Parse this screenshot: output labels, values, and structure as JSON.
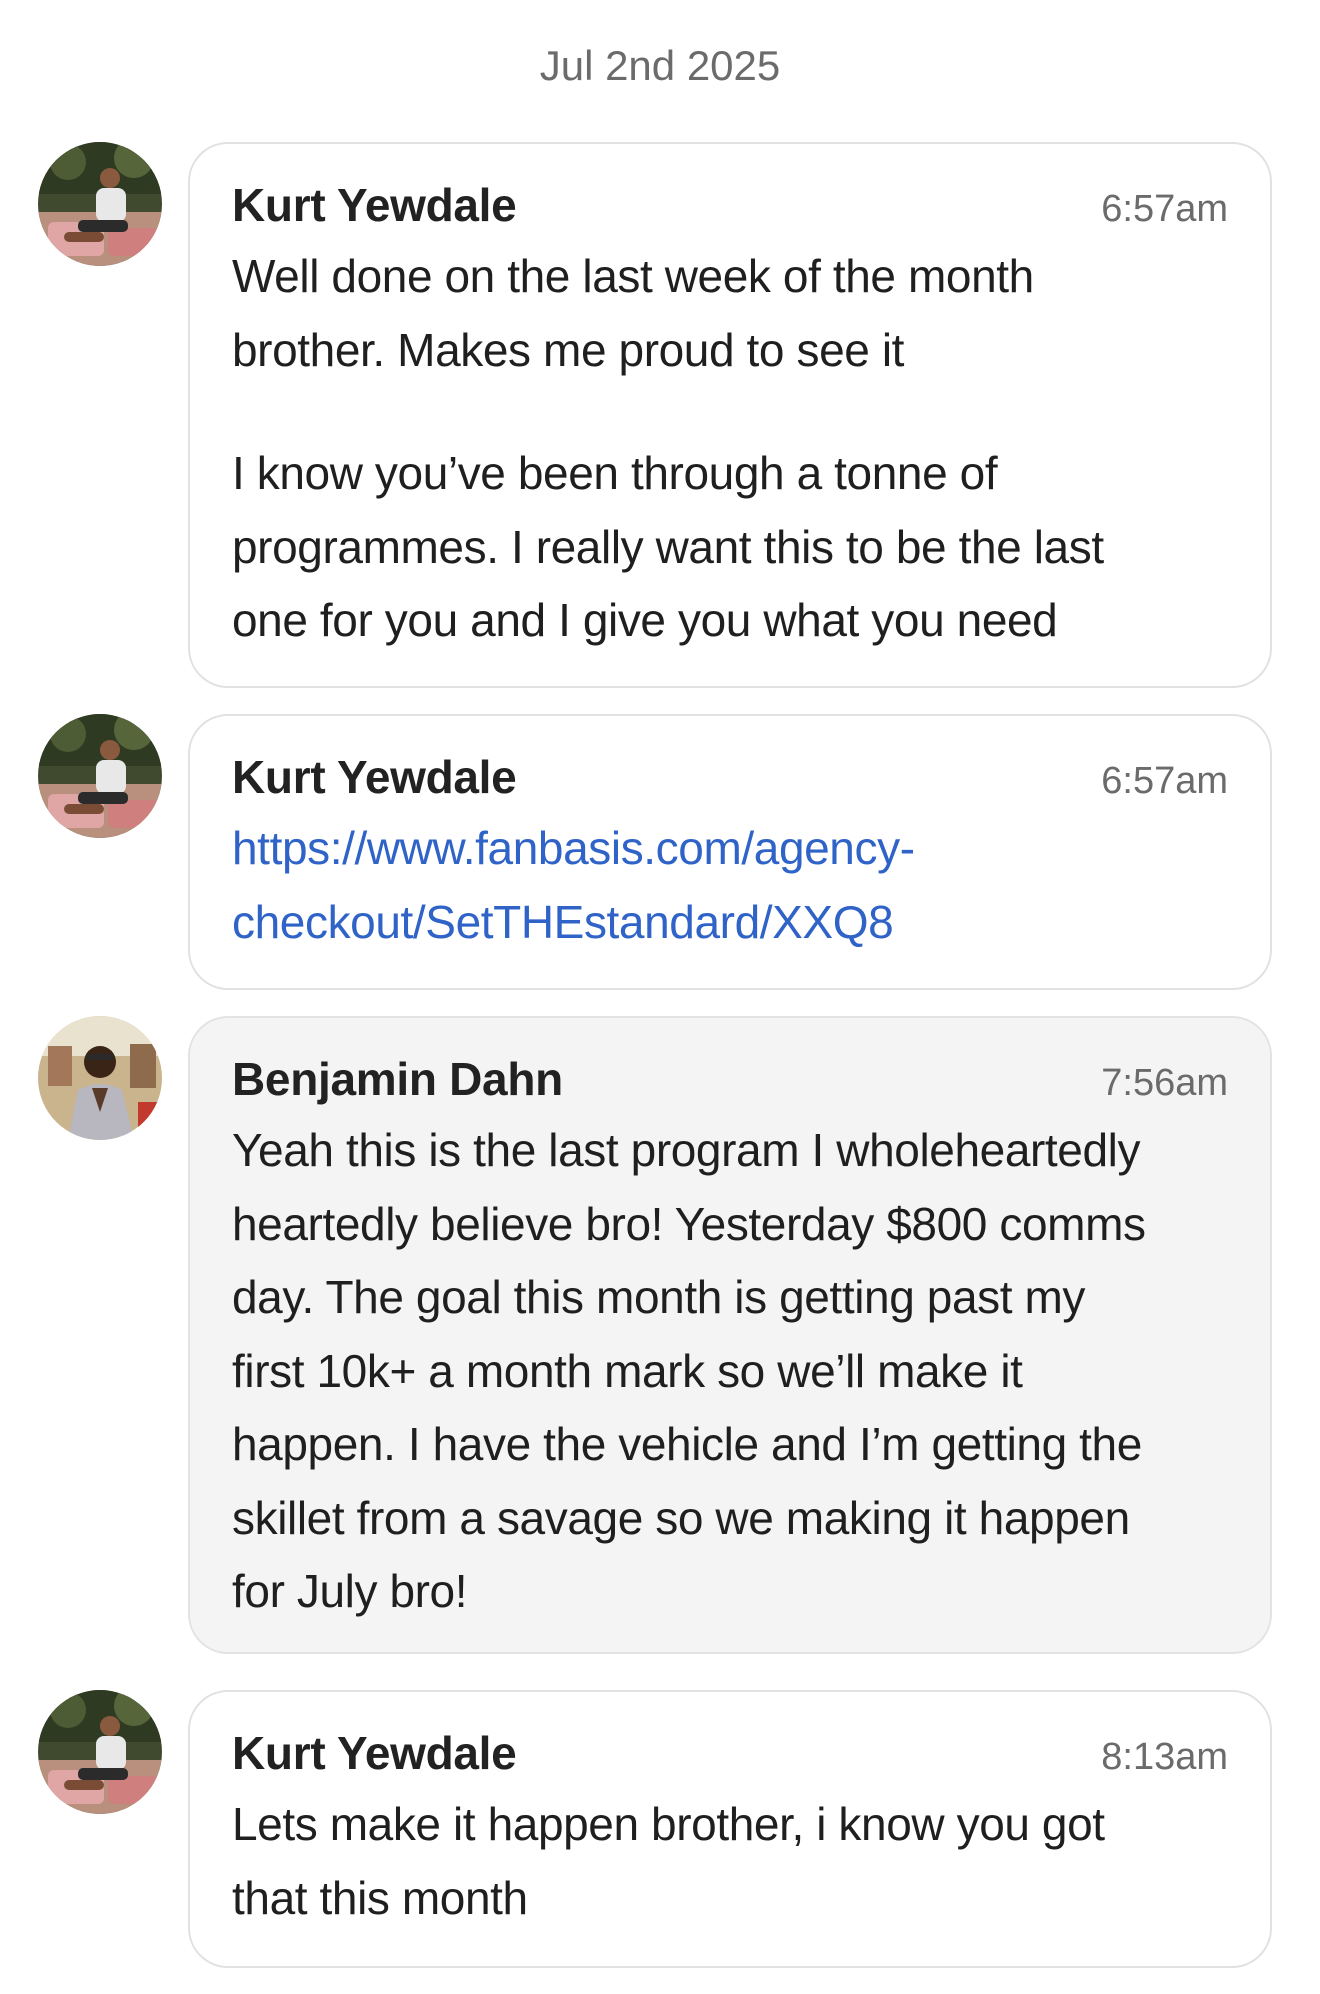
{
  "conversation": {
    "date": "Jul 2nd 2025",
    "messages": [
      {
        "sender": "Kurt Yewdale",
        "time": "6:57am",
        "paragraph1": [
          "Well done on the last week of the month",
          "brother. Makes me proud to see it"
        ],
        "paragraph2": [
          "I know you’ve been through a tonne of",
          "programmes. I really want this to be the last",
          "one for you and I give you what you need"
        ]
      },
      {
        "sender": "Kurt Yewdale",
        "time": "6:57am",
        "link": [
          "https://www.fanbasis.com/agency-",
          "checkout/SetTHEstandard/XXQ8"
        ]
      },
      {
        "sender": "Benjamin Dahn",
        "time": "7:56am",
        "lines": [
          "Yeah this is the last program I wholeheartedly",
          "heartedly believe bro! Yesterday $800 comms",
          "day. The goal this month is getting past my",
          "first 10k+ a month mark so we’ll make it",
          "happen. I have the vehicle and I’m getting the",
          "skillet from a savage so we making it happen",
          "for July bro!"
        ]
      },
      {
        "sender": "Kurt Yewdale",
        "time": "8:13am",
        "lines": [
          "Lets make it happen brother, i know you got",
          "that this month"
        ]
      }
    ]
  },
  "colors": {
    "link": "#2f63c8",
    "incoming_bubble": "#f4f4f4",
    "outgoing_bubble": "#ffffff",
    "border": "#e1e1e1"
  }
}
